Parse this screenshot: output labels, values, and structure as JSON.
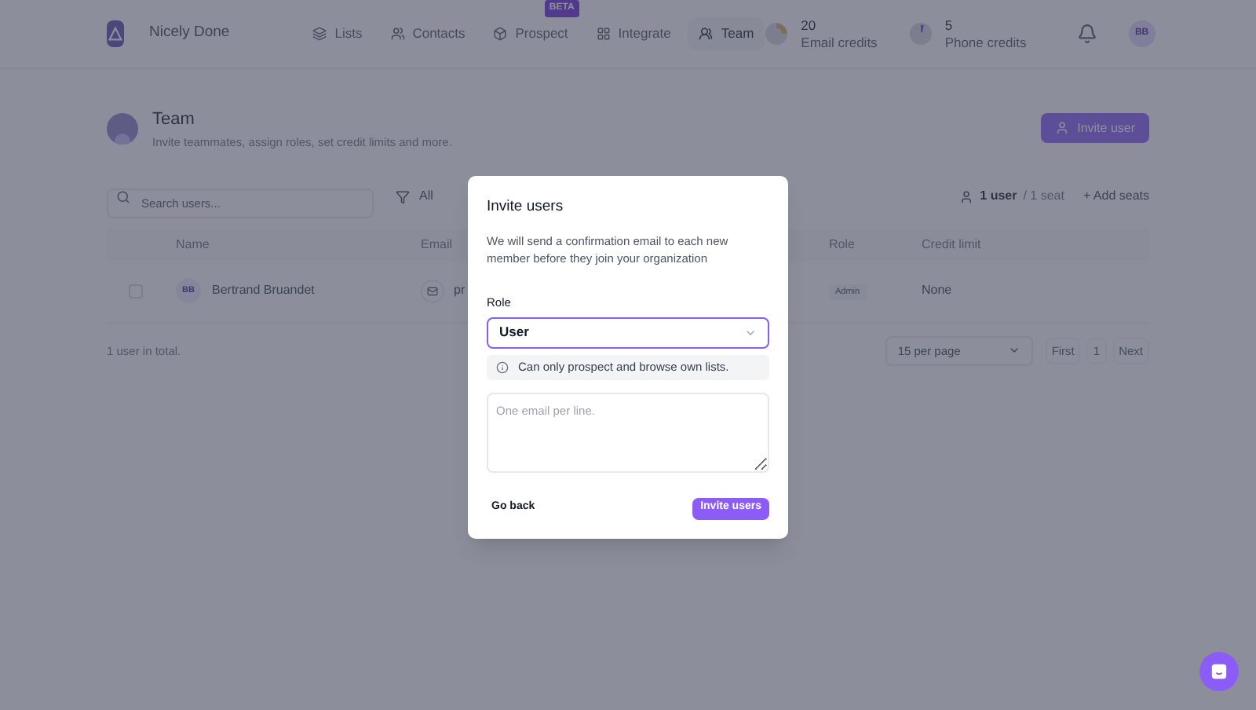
{
  "workspace": {
    "name": "Nicely Done"
  },
  "nav": [
    {
      "label": "Lists",
      "selected": false
    },
    {
      "label": "Contacts",
      "selected": false
    },
    {
      "label": "Prospect",
      "badge": "BETA",
      "selected": false
    },
    {
      "label": "Integrate",
      "selected": false
    },
    {
      "label": "Team",
      "selected": true
    }
  ],
  "credits": [
    {
      "value": "20",
      "label": "Email credits"
    },
    {
      "value": "5",
      "label": "Phone credits"
    }
  ],
  "user_initials": "BB",
  "page": {
    "title": "Team",
    "subtitle": "Invite teammates, assign roles, set credit limits and more.",
    "invite_button": "Invite user"
  },
  "toolbar": {
    "search_placeholder": "Search users...",
    "filter": "All",
    "seats_count": "1 user",
    "seats_total": "/ 1 seat",
    "add_seats": "+ Add seats"
  },
  "table": {
    "columns": [
      "Name",
      "Email",
      "Role",
      "Credit limit"
    ],
    "rows": [
      {
        "initials": "BB",
        "name": "Bertrand Bruandet",
        "email": "pr",
        "role": "Admin",
        "credit_limit": "None",
        "checked": false
      }
    ]
  },
  "footer": {
    "total": "1 user in total.",
    "per_page": "15 per page",
    "first": "First",
    "page": "1",
    "next": "Next"
  },
  "dialog": {
    "title": "Invite users",
    "description": "We will send a confirmation email to each new member before they join your organization",
    "role_label": "Role",
    "role_value": "User",
    "role_hint": "Can only prospect and browse own lists.",
    "emails_placeholder": "One email per line.",
    "cancel": "Go back",
    "submit": "Invite users"
  }
}
